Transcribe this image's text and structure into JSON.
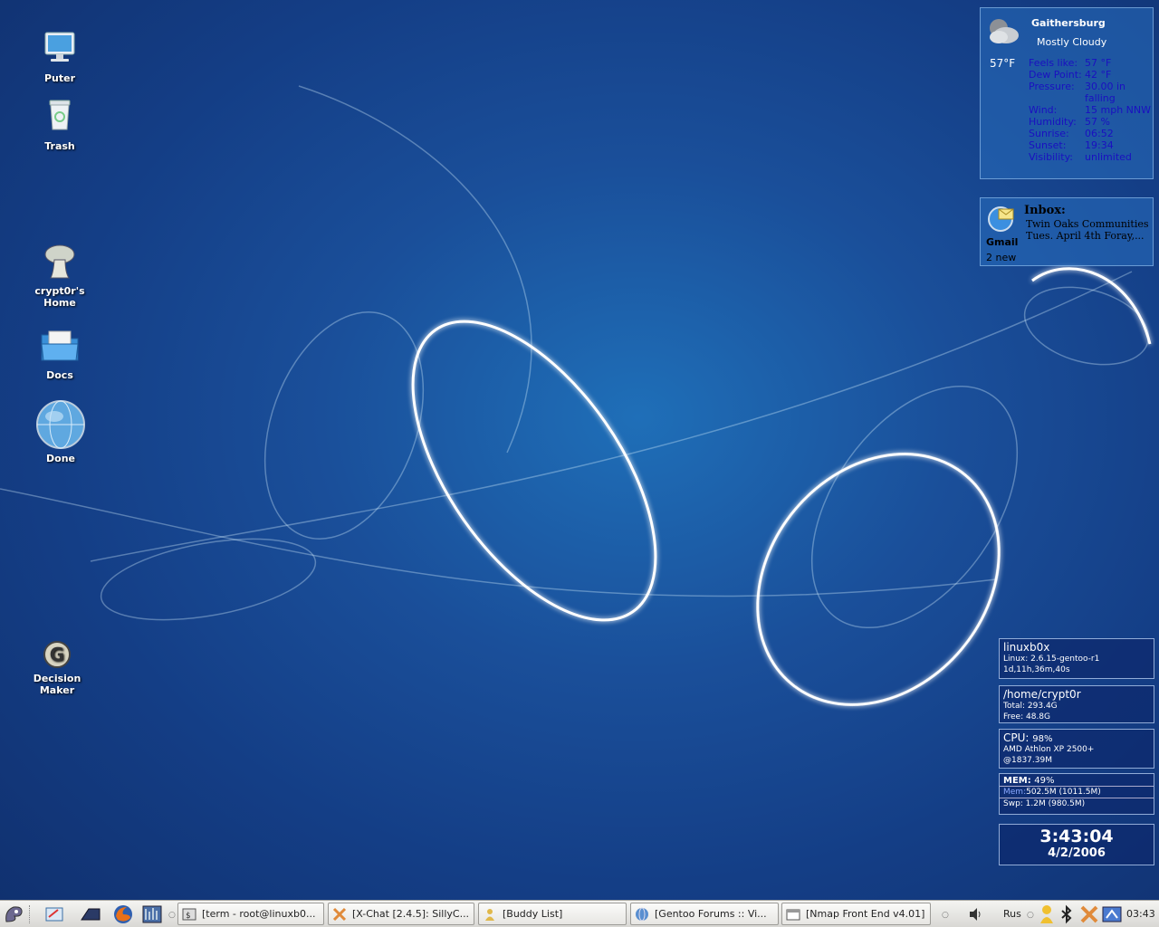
{
  "desktop": {
    "icons": [
      {
        "label": "Puter",
        "icon": "computer-icon"
      },
      {
        "label": "Trash",
        "icon": "trash-icon"
      },
      {
        "label": "crypt0r's Home",
        "icon": "home-mushroom-icon"
      },
      {
        "label": "Docs",
        "icon": "folder-icon"
      },
      {
        "label": "Done",
        "icon": "globe-icon"
      },
      {
        "label": "Decision Maker",
        "icon": "gimp-icon"
      }
    ]
  },
  "weather": {
    "city": "Gaithersburg",
    "condition": "Mostly Cloudy",
    "temperature": "57°F",
    "rows": [
      {
        "key": "Feels like:",
        "value": "57 °F"
      },
      {
        "key": "Dew Point:",
        "value": "42 °F"
      },
      {
        "key": "Pressure:",
        "value": "30.00 in falling"
      },
      {
        "key": "Wind:",
        "value": "15 mph NNW"
      },
      {
        "key": "Humidity:",
        "value": "57 %"
      },
      {
        "key": "Sunrise:",
        "value": "06:52"
      },
      {
        "key": "Sunset:",
        "value": "19:34"
      },
      {
        "key": "Visibility:",
        "value": "unlimited"
      }
    ]
  },
  "gmail": {
    "inbox_label": "Inbox:",
    "message": "Twin Oaks Communities Tues. April 4th Foray,...",
    "message_line1": "Twin Oaks Communities",
    "message_line2": "Tues. April 4th Foray,...",
    "name": "Gmail",
    "count": "2 new"
  },
  "system": {
    "host": {
      "title": "linuxb0x",
      "line1": "Linux: 2.6.15-gentoo-r1",
      "line2": "1d,11h,36m,40s"
    },
    "disk": {
      "title": "/home/crypt0r",
      "line1": "Total: 293.4G",
      "line2": "Free: 48.8G"
    },
    "cpu": {
      "title": "CPU:",
      "value": "98%",
      "line1": "AMD Athlon XP 2500+",
      "line2": "@1837.39M"
    },
    "mem": {
      "title": "MEM:",
      "value": "49%",
      "mem_label": "Mem:",
      "mem_value": "502.5M (1011.5M)",
      "swp": "Swp: 1.2M (980.5M)"
    },
    "clock": {
      "time": "3:43:04",
      "date": "4/2/2006"
    }
  },
  "taskbar": {
    "tasks": [
      {
        "label": "[term - root@linuxb0...",
        "icon": "terminal-icon"
      },
      {
        "label": "[X-Chat [2.4.5]: SillyC...",
        "icon": "xchat-icon"
      },
      {
        "label": "[Buddy List]",
        "icon": "gaim-icon"
      },
      {
        "label": "[Gentoo Forums :: Vi...",
        "icon": "browser-icon"
      },
      {
        "label": "[Nmap Front End v4.01]",
        "icon": "window-icon"
      }
    ],
    "keyboard_layout": "Rus",
    "clock": "03:43"
  },
  "colors": {
    "desktop_bg": "#1a4f9a",
    "panel_bg": "#286ebe",
    "weather_value_text": "#1a10c0",
    "taskbar_bg": "#e7e6e3"
  }
}
